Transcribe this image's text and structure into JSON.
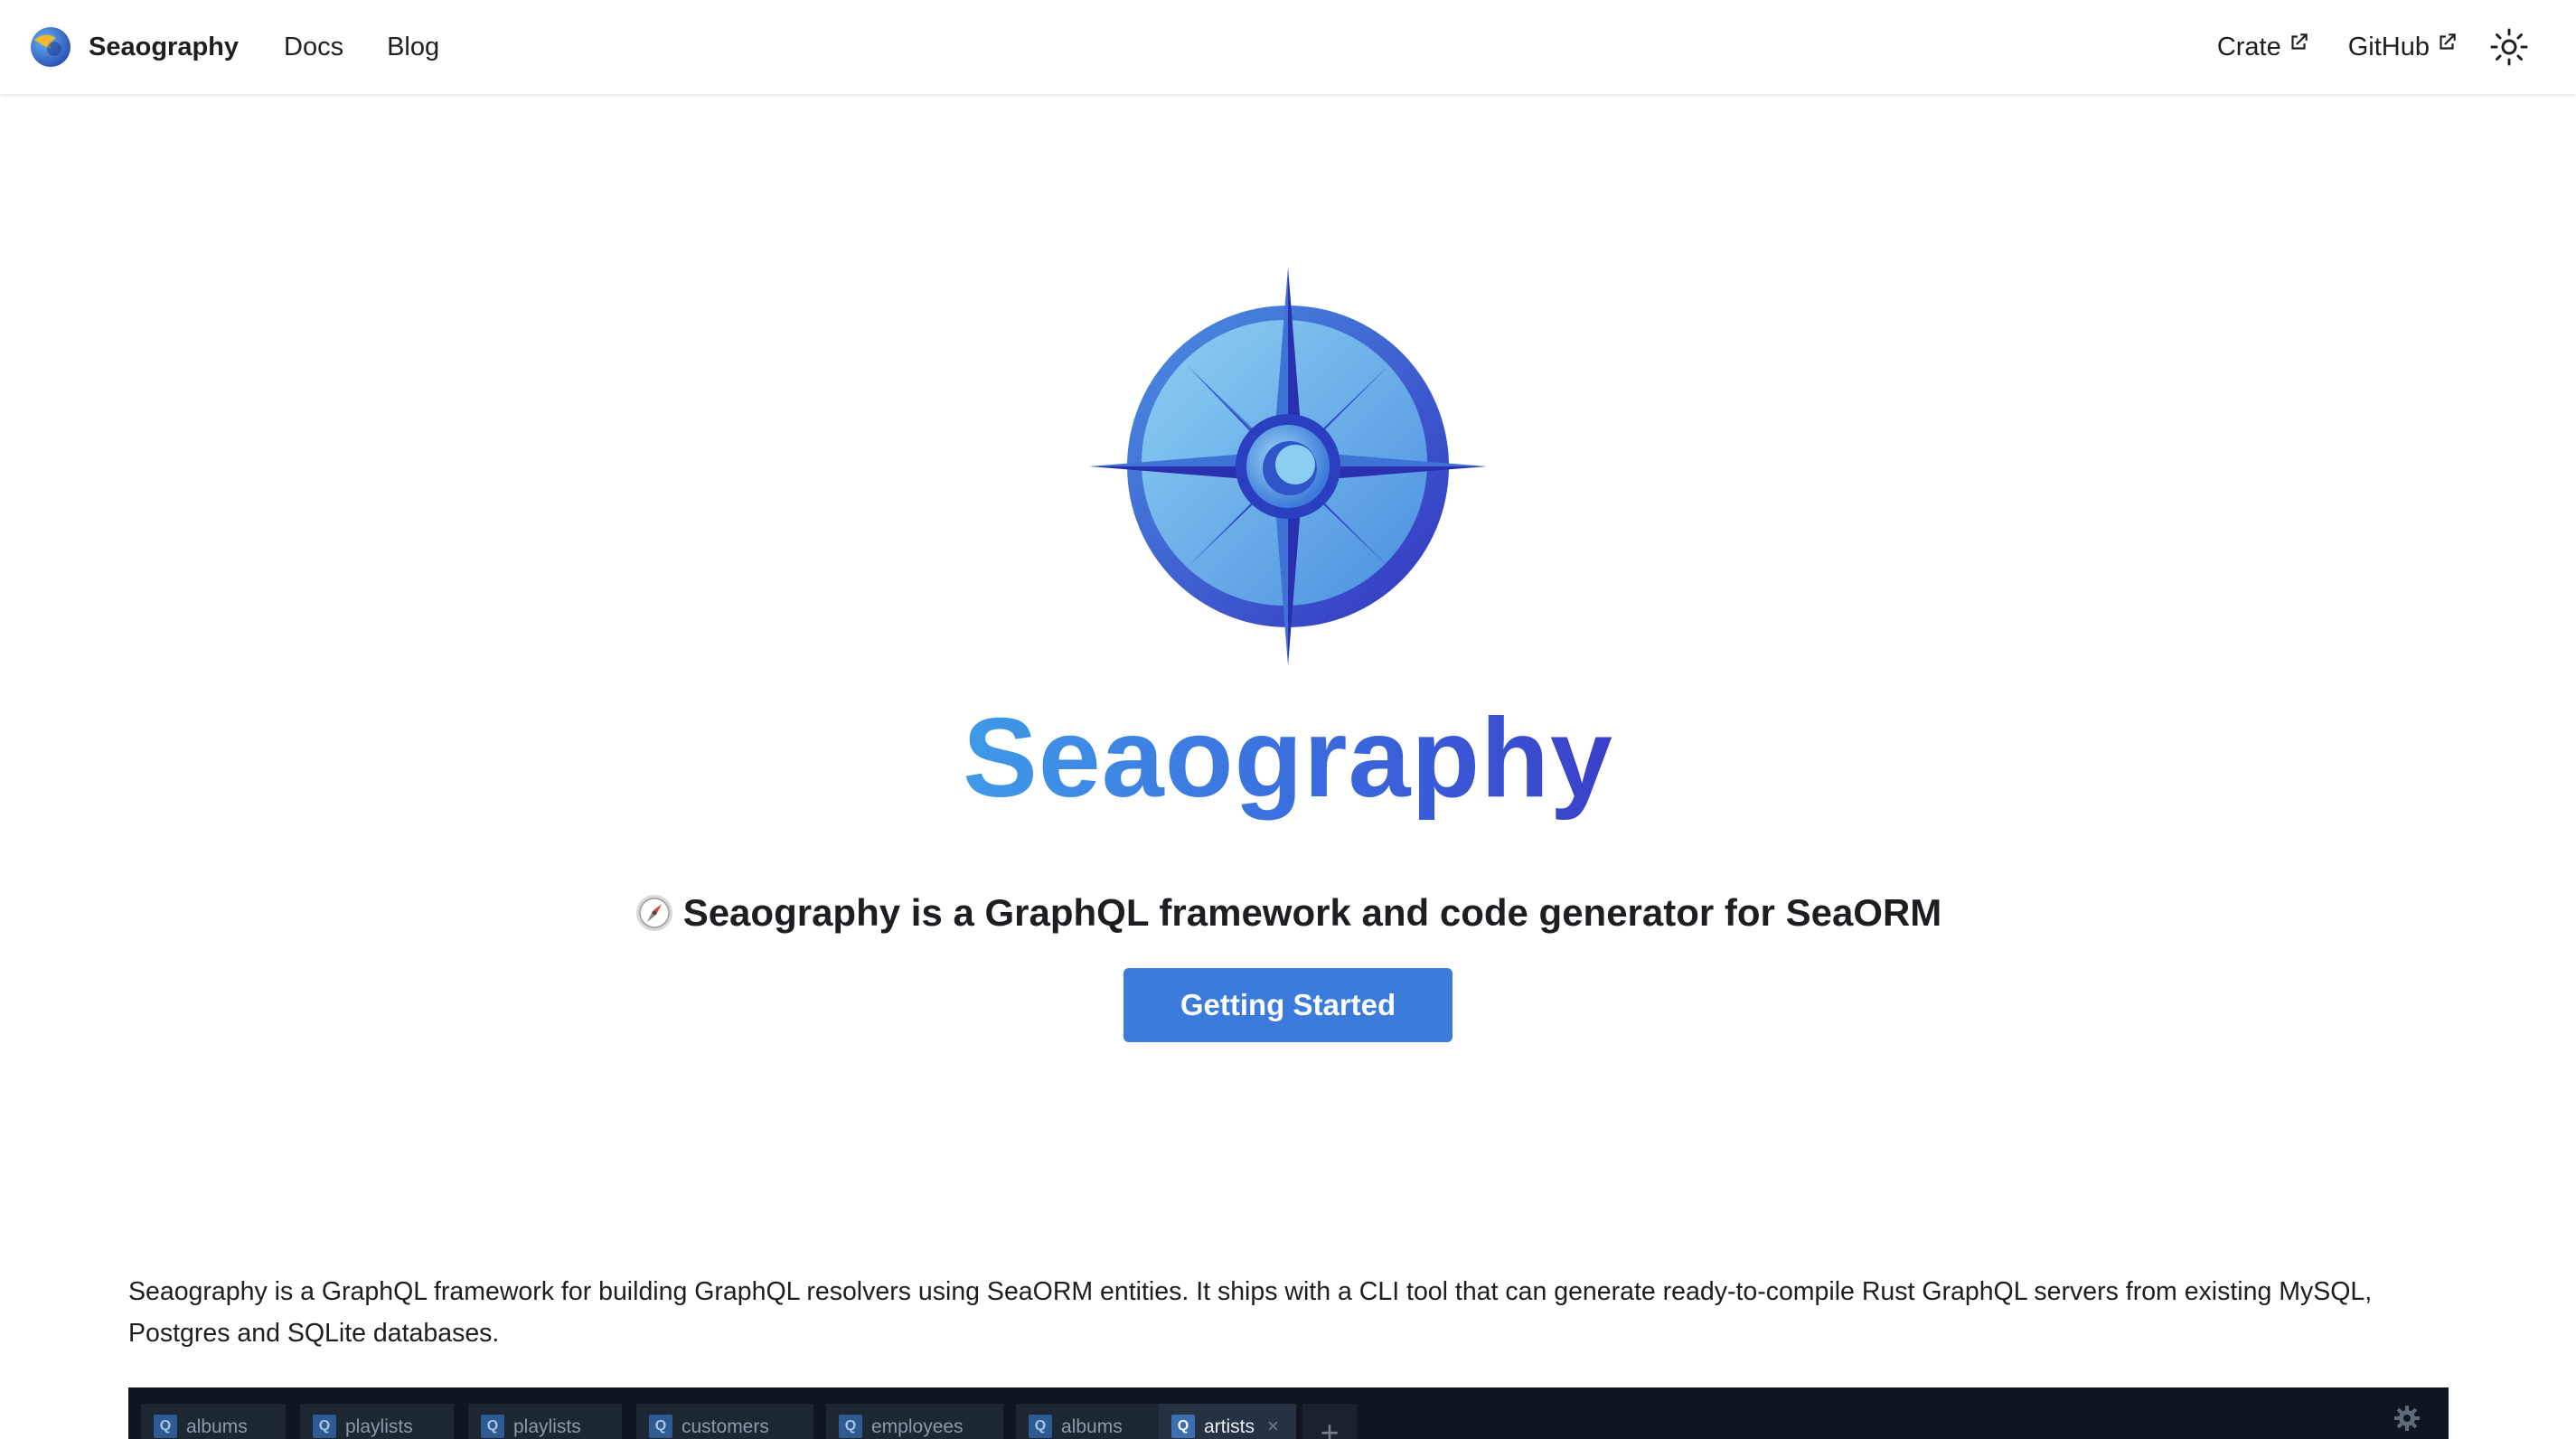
{
  "navbar": {
    "brand_title": "Seaography",
    "links": [
      "Docs",
      "Blog"
    ],
    "external_links": [
      "Crate",
      "GitHub"
    ],
    "theme_toggle_icon": "sun-icon"
  },
  "hero": {
    "wordmark": "Seaography",
    "tagline": "Seaography is a GraphQL framework and code generator for SeaORM",
    "tagline_icon": "compass-emoji",
    "cta_label": "Getting Started",
    "cta_color": "#3a7bdc",
    "logo_colors": {
      "light": "#7fc1ee",
      "dark": "#3434c0",
      "accent": "#3f9ae8"
    }
  },
  "description": "Seaography is a GraphQL framework for building GraphQL resolvers using SeaORM entities. It ships with a CLI tool that can generate ready-to-compile Rust GraphQL servers from existing MySQL, Postgres and SQLite databases.",
  "preview": {
    "tabs": [
      {
        "icon": "Q",
        "label": "albums",
        "active": false
      },
      {
        "icon": "Q",
        "label": "playlists",
        "active": false
      },
      {
        "icon": "Q",
        "label": "playlists",
        "active": false
      },
      {
        "icon": "Q",
        "label": "customers",
        "active": false
      },
      {
        "icon": "Q",
        "label": "employees",
        "active": false
      },
      {
        "icon": "Q",
        "label": "albums",
        "active": false
      },
      {
        "icon": "Q",
        "label": "artists",
        "active": true
      }
    ],
    "close_glyph": "×",
    "add_glyph": "+",
    "settings_icon": "gear-icon",
    "background": "#0f1620"
  }
}
